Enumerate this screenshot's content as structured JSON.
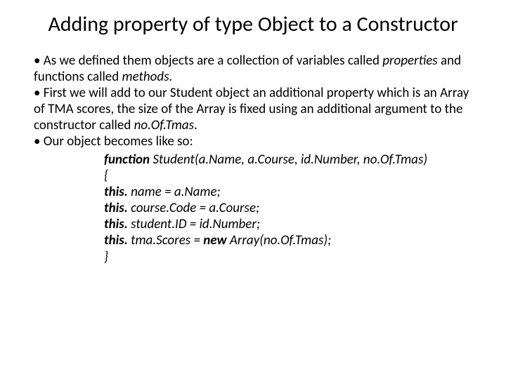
{
  "title": "Adding property of type Object to a Constructor",
  "bullets": {
    "b1_pre": "• As we defined them objects are a collection of variables called ",
    "b1_em1": "properties",
    "b1_mid": " and functions called ",
    "b1_em2": "methods.",
    "b2_pre": "• First we will add to our Student object an additional property which is an Array of TMA scores, the size of the Array is fixed using an additional argument to the constructor called ",
    "b2_em": "no.Of.Tmas",
    "b2_post": ".",
    "b3": "• Our object becomes like so:"
  },
  "code": {
    "l1_fn": "function",
    "l1_rest": " Student(a.Name, a.Course, id.Number, no.Of.Tmas)",
    "l2": "{",
    "l3_pre": "this.",
    "l3_rest": " name = a.Name;",
    "l4_pre": "this.",
    "l4_rest": " course.Code = a.Course;",
    "l5_pre": "this.",
    "l5_rest": " student.ID = id.Number;",
    "l6_pre": "this.",
    "l6_mid": " tma.Scores = ",
    "l6_new": "new",
    "l6_rest": " Array(no.Of.Tmas);",
    "l7": "}"
  }
}
